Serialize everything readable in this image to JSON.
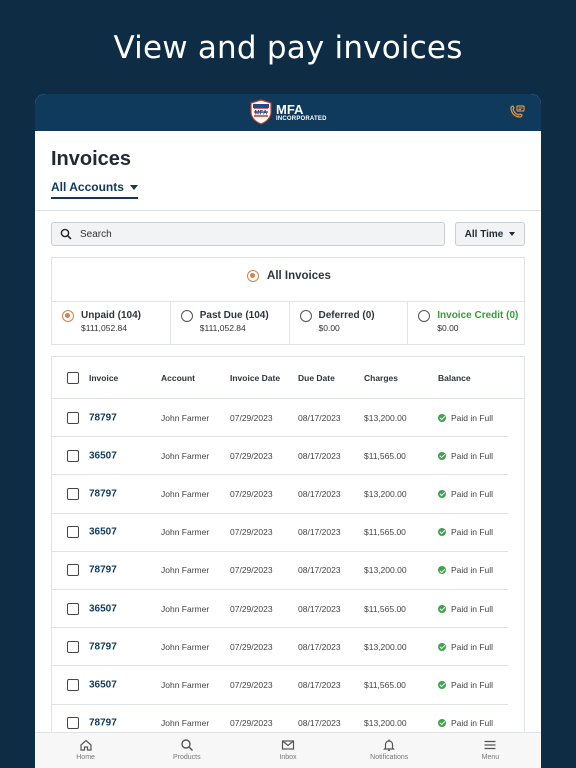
{
  "headline": "View and pay invoices",
  "brand": {
    "name": "MFA",
    "sub": "INCORPORATED"
  },
  "page_title": "Invoices",
  "account_filter": "All Accounts",
  "search": {
    "placeholder": "Search"
  },
  "time_filter": "All Time",
  "all_invoices_label": "All Invoices",
  "segments": [
    {
      "label": "Unpaid (104)",
      "amount": "$111,052.84",
      "selected": true
    },
    {
      "label": "Past Due (104)",
      "amount": "$111,052.84",
      "selected": false
    },
    {
      "label": "Deferred (0)",
      "amount": "$0.00",
      "selected": false
    },
    {
      "label": "Invoice Credit (0)",
      "amount": "$0.00",
      "selected": false
    }
  ],
  "table": {
    "headers": [
      "Invoice",
      "Account",
      "Invoice Date",
      "Due Date",
      "Charges",
      "Balance"
    ],
    "rows": [
      [
        "78797",
        "John Farmer",
        "07/29/2023",
        "08/17/2023",
        "$13,200.00",
        "Paid in Full"
      ],
      [
        "36507",
        "John Farmer",
        "07/29/2023",
        "08/17/2023",
        "$11,565.00",
        "Paid in Full"
      ],
      [
        "78797",
        "John Farmer",
        "07/29/2023",
        "08/17/2023",
        "$13,200.00",
        "Paid in Full"
      ],
      [
        "36507",
        "John Farmer",
        "07/29/2023",
        "08/17/2023",
        "$11,565.00",
        "Paid in Full"
      ],
      [
        "78797",
        "John Farmer",
        "07/29/2023",
        "08/17/2023",
        "$13,200.00",
        "Paid in Full"
      ],
      [
        "36507",
        "John Farmer",
        "07/29/2023",
        "08/17/2023",
        "$11,565.00",
        "Paid in Full"
      ],
      [
        "78797",
        "John Farmer",
        "07/29/2023",
        "08/17/2023",
        "$13,200.00",
        "Paid in Full"
      ],
      [
        "36507",
        "John Farmer",
        "07/29/2023",
        "08/17/2023",
        "$11,565.00",
        "Paid in Full"
      ],
      [
        "78797",
        "John Farmer",
        "07/29/2023",
        "08/17/2023",
        "$13,200.00",
        "Paid in Full"
      ]
    ]
  },
  "nav": [
    {
      "label": "Home",
      "icon": "home-icon"
    },
    {
      "label": "Products",
      "icon": "search-icon"
    },
    {
      "label": "Inbox",
      "icon": "mail-icon"
    },
    {
      "label": "Notifications",
      "icon": "bell-icon"
    },
    {
      "label": "Menu",
      "icon": "menu-icon"
    }
  ],
  "colors": {
    "brand_navy": "#0f3a5c",
    "accent_orange": "#d4814a",
    "paid_green": "#3fa34d",
    "credit_green": "#3b9a3b",
    "background": "#0e2c44"
  }
}
